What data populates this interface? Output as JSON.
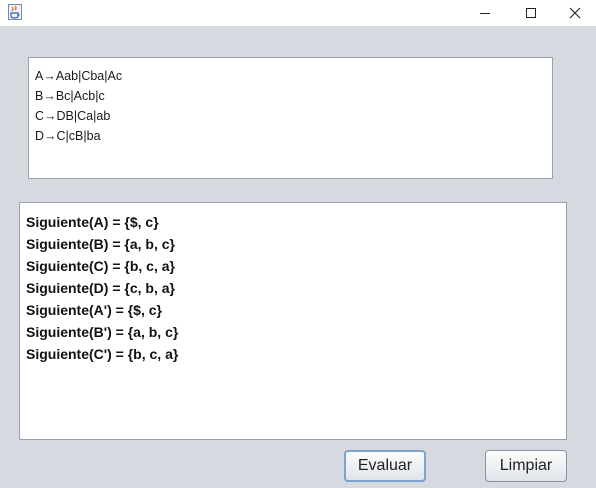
{
  "window": {
    "icon": "java-cup-icon",
    "controls": [
      "minimize-icon",
      "maximize-icon",
      "close-icon"
    ]
  },
  "grammar": {
    "lines": [
      "A→Aab|Cba|Ac",
      "B→Bc|Acb|c",
      "C→DB|Ca|ab",
      "D→C|cB|ba"
    ]
  },
  "results": {
    "lines": [
      "Siguiente(A) = {$, c}",
      "Siguiente(B) = {a, b, c}",
      "Siguiente(C) = {b, c, a}",
      "Siguiente(D) = {c, b, a}",
      "Siguiente(A') = {$, c}",
      "Siguiente(B') = {a, b, c}",
      "Siguiente(C') = {b, c, a}"
    ]
  },
  "buttons": {
    "evaluate": "Evaluar",
    "clear": "Limpiar"
  }
}
